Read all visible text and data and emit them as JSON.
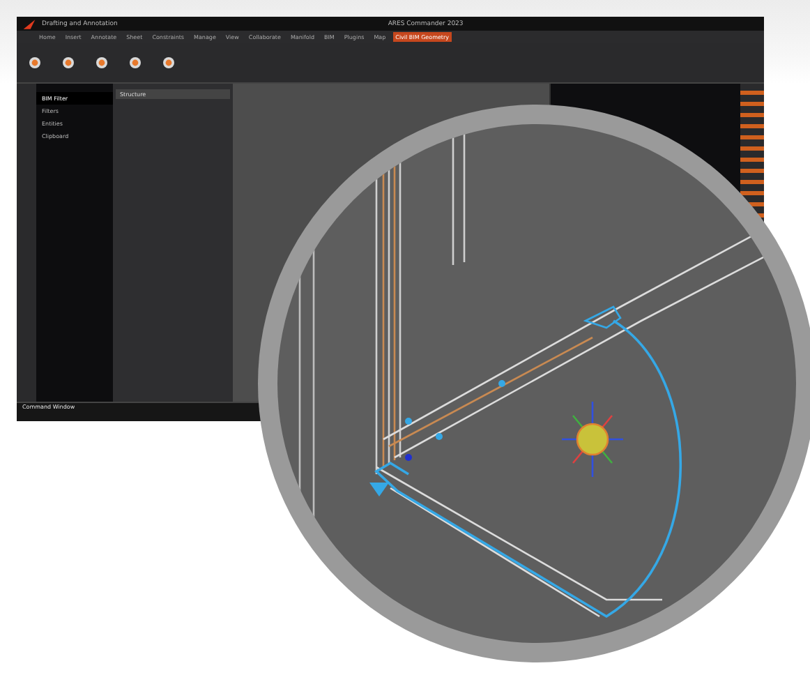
{
  "window": {
    "workspace": "Drafting and Annotation",
    "title": "ARES Commander 2023"
  },
  "ribbon_tabs": [
    {
      "label": "Home",
      "selected": false
    },
    {
      "label": "Insert",
      "selected": false
    },
    {
      "label": "Annotate",
      "selected": false
    },
    {
      "label": "Sheet",
      "selected": false
    },
    {
      "label": "Constraints",
      "selected": false
    },
    {
      "label": "Manage",
      "selected": false
    },
    {
      "label": "View",
      "selected": false
    },
    {
      "label": "Collaborate",
      "selected": false
    },
    {
      "label": "Manifold",
      "selected": false
    },
    {
      "label": "BIM",
      "selected": false
    },
    {
      "label": "Plugins",
      "selected": false
    },
    {
      "label": "Map",
      "selected": false
    },
    {
      "label": "Civil BIM Geometry",
      "selected": true
    }
  ],
  "browser": {
    "items": [
      {
        "label": "BIM Filter",
        "selected": true
      },
      {
        "label": "Filters",
        "selected": false
      },
      {
        "label": "Entities",
        "selected": false
      },
      {
        "label": "Clipboard",
        "selected": false
      }
    ]
  },
  "properties": {
    "title": "Structure"
  },
  "command_window": {
    "title": "Command Window"
  }
}
